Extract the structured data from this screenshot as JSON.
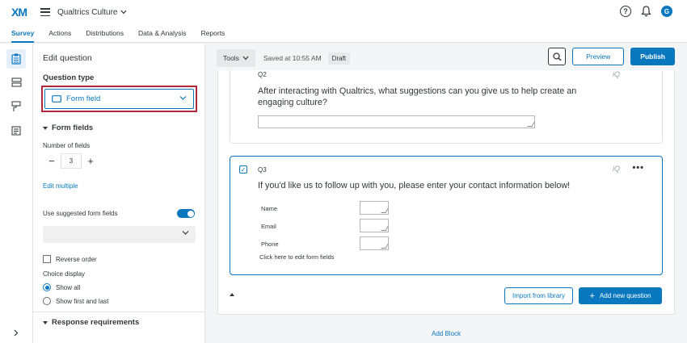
{
  "app": {
    "logo": "XM",
    "project": "Qualtrics Culture",
    "help": "?",
    "avatar_initial": "G"
  },
  "tabs": [
    "Survey",
    "Actions",
    "Distributions",
    "Data & Analysis",
    "Reports"
  ],
  "panel": {
    "title": "Edit question",
    "question_type_label": "Question type",
    "question_type_value": "Form field",
    "form_fields_header": "Form fields",
    "number_of_fields_label": "Number of fields",
    "number_of_fields_value": "3",
    "edit_multiple": "Edit multiple",
    "use_suggested_label": "Use suggested form fields",
    "use_suggested_on": true,
    "reverse_order": "Reverse order",
    "choice_display_label": "Choice display",
    "show_all": "Show all",
    "show_first_last": "Show first and last",
    "response_requirements": "Response requirements"
  },
  "toolbar": {
    "tools": "Tools",
    "saved": "Saved at 10:55 AM",
    "status": "Draft",
    "preview": "Preview",
    "publish": "Publish"
  },
  "questions": {
    "q2": {
      "id": "Q2",
      "text_line1": "After interacting with Qualtrics, what suggestions can you give us to help create an",
      "text_line2": "engaging culture?",
      "iq": "iQ"
    },
    "q3": {
      "id": "Q3",
      "text": "If you'd like us to follow up with you, please enter your contact information below!",
      "iq": "iQ",
      "fields": [
        "Name",
        "Email",
        "Phone"
      ],
      "edit_link": "Click here to edit form fields"
    }
  },
  "actions": {
    "import": "Import from library",
    "add_new": "Add new question",
    "add_block": "Add Block"
  },
  "colors": {
    "accent": "#0a78be",
    "highlight": "#b0283a"
  }
}
